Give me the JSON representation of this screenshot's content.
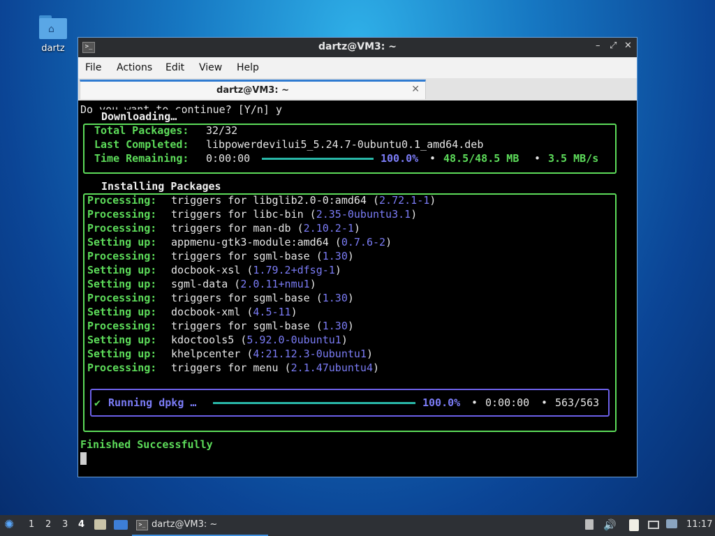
{
  "desktop": {
    "icon_label": "dartz"
  },
  "window": {
    "title": "dartz@VM3: ~",
    "icon_text": ">_",
    "controls": {
      "minimize": "–",
      "restore": "⤢",
      "close": "✕"
    },
    "menu": [
      "File",
      "Actions",
      "Edit",
      "View",
      "Help"
    ],
    "tab": {
      "label": "dartz@VM3: ~",
      "close": "✕"
    }
  },
  "terminal": {
    "prompt_line": "Do you want to continue? [Y/n] y",
    "download": {
      "title": "Downloading…",
      "total_label": "Total Packages:",
      "total_value": "32/32",
      "last_label": "Last Completed:",
      "last_value": "libpowerdevilui5_5.24.7-0ubuntu0.1_amd64.deb",
      "time_label": "Time Remaining:",
      "time_value": "0:00:00",
      "percent": "100.0%",
      "size": "48.5/48.5 MB",
      "speed": "3.5 MB/s",
      "sep": "•"
    },
    "install": {
      "title": "Installing Packages",
      "lines": [
        {
          "label": "Processing:",
          "text": "triggers for libglib2.0-0:amd64",
          "version": "2.72.1-1"
        },
        {
          "label": "Processing:",
          "text": "triggers for libc-bin",
          "version": "2.35-0ubuntu3.1"
        },
        {
          "label": "Processing:",
          "text": "triggers for man-db",
          "version": "2.10.2-1"
        },
        {
          "label": "Setting up:",
          "text": "appmenu-gtk3-module:amd64",
          "version": "0.7.6-2"
        },
        {
          "label": "Processing:",
          "text": "triggers for sgml-base",
          "version": "1.30"
        },
        {
          "label": "Setting up:",
          "text": "docbook-xsl",
          "version": "1.79.2+dfsg-1"
        },
        {
          "label": "Setting up:",
          "text": "sgml-data",
          "version": "2.0.11+nmu1"
        },
        {
          "label": "Processing:",
          "text": "triggers for sgml-base",
          "version": "1.30"
        },
        {
          "label": "Setting up:",
          "text": "docbook-xml",
          "version": "4.5-11"
        },
        {
          "label": "Processing:",
          "text": "triggers for sgml-base",
          "version": "1.30"
        },
        {
          "label": "Setting up:",
          "text": "kdoctools5",
          "version": "5.92.0-0ubuntu1"
        },
        {
          "label": "Setting up:",
          "text": "khelpcenter",
          "version": "4:21.12.3-0ubuntu1"
        },
        {
          "label": "Processing:",
          "text": "triggers for menu",
          "version": "2.1.47ubuntu4"
        }
      ],
      "dpkg": {
        "check": "✔",
        "label": "Running dpkg …",
        "percent": "100.0%",
        "time": "0:00:00",
        "count": "563/563",
        "sep": "•"
      }
    },
    "finished": "Finished Successfully"
  },
  "taskbar": {
    "workspaces": [
      "1",
      "2",
      "3",
      "4"
    ],
    "active_workspace": "4",
    "task_title": "dartz@VM3: ~",
    "clock": "11:17"
  }
}
